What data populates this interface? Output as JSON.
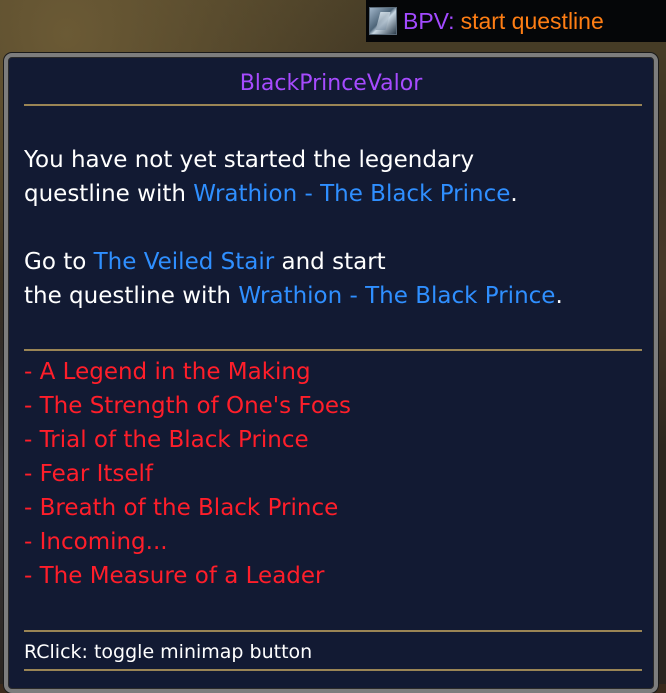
{
  "broker": {
    "icon": "blackprince-icon",
    "label": "BPV:",
    "value": "start questline"
  },
  "tooltip": {
    "title": "BlackPrinceValor",
    "para1": {
      "line1": "You have not yet started the legendary",
      "line2_pre": "questline with ",
      "line2_link": "Wrathion - The Black Prince",
      "line2_post": "."
    },
    "para2": {
      "line1_pre": "Go to ",
      "line1_link": "The Veiled Stair",
      "line1_post": " and start",
      "line2_pre": "the questline with ",
      "line2_link": "Wrathion - The Black Prince",
      "line2_post": "."
    },
    "quests": [
      "- A Legend in the Making",
      "- The Strength of One's Foes",
      "- Trial of the Black Prince",
      "- Fear Itself",
      "- Breath of the Black Prince",
      "- Incoming...",
      "- The Measure of a Leader"
    ],
    "hint": "RClick: toggle minimap button"
  },
  "colors": {
    "title": "#a74bff",
    "link": "#2f8fff",
    "quest": "#ff1e2a",
    "broker_value": "#ff7e14",
    "divider": "#9a8555",
    "tooltip_bg": "#121a33"
  }
}
